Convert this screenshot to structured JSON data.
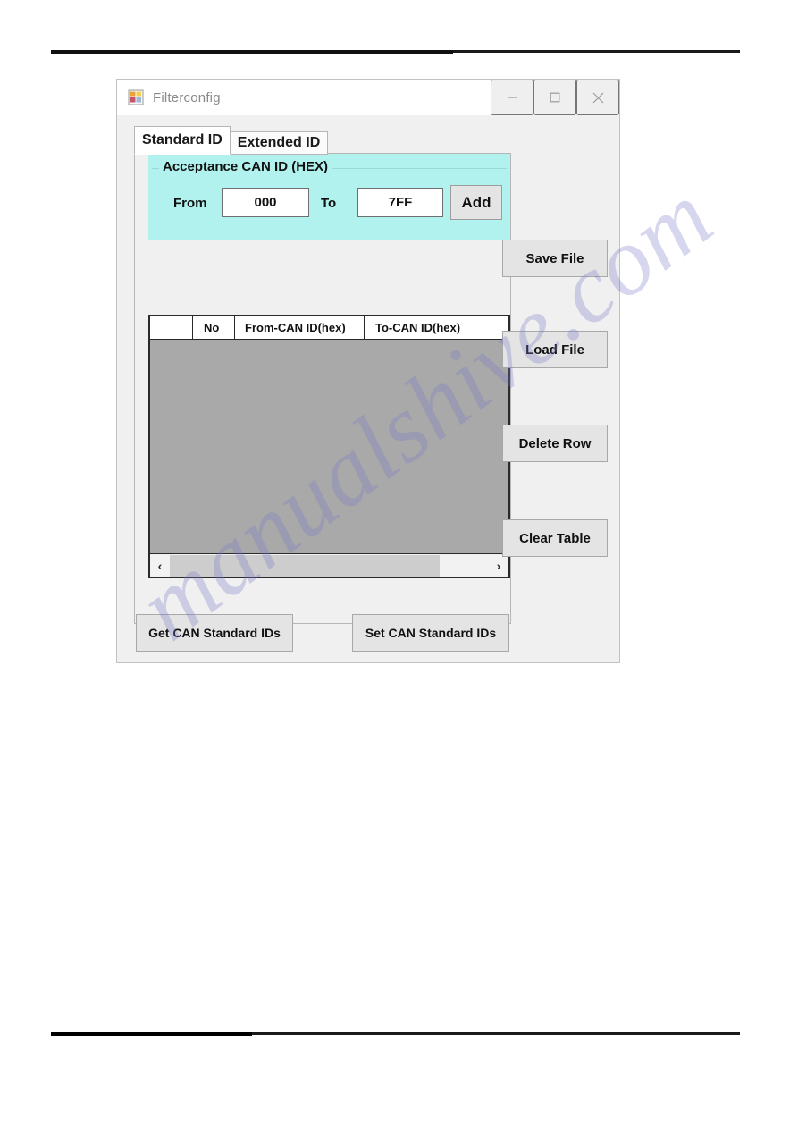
{
  "window": {
    "title": "Filterconfig",
    "icon": "winforms-app-icon",
    "controls": {
      "minimize": "–",
      "maximize": "□",
      "close": "×",
      "minimize_name": "minimize-icon",
      "maximize_name": "maximize-icon",
      "close_name": "close-icon"
    }
  },
  "tabs": [
    {
      "label": "Standard ID",
      "active": true
    },
    {
      "label": "Extended ID",
      "active": false
    }
  ],
  "groupbox": {
    "title": "Acceptance CAN ID (HEX)",
    "background_color": "#b1f2ee",
    "from_label": "From",
    "from_value": "000",
    "to_label": "To",
    "to_value": "7FF",
    "add_label": "Add"
  },
  "grid": {
    "columns": [
      "",
      "No",
      "From-CAN ID(hex)",
      "To-CAN ID(hex)"
    ],
    "rows": [],
    "empty_area_color": "#a9a9a9",
    "scrollbar": {
      "left_arrow": "‹",
      "right_arrow": "›"
    }
  },
  "side_buttons": [
    {
      "label": "Save File"
    },
    {
      "label": "Load File"
    },
    {
      "label": "Delete Row"
    },
    {
      "label": "Clear Table"
    }
  ],
  "bottom_buttons": [
    {
      "label": "Get CAN Standard IDs"
    },
    {
      "label": "Set CAN Standard IDs"
    }
  ],
  "watermark": {
    "text": "manualshive.com"
  }
}
